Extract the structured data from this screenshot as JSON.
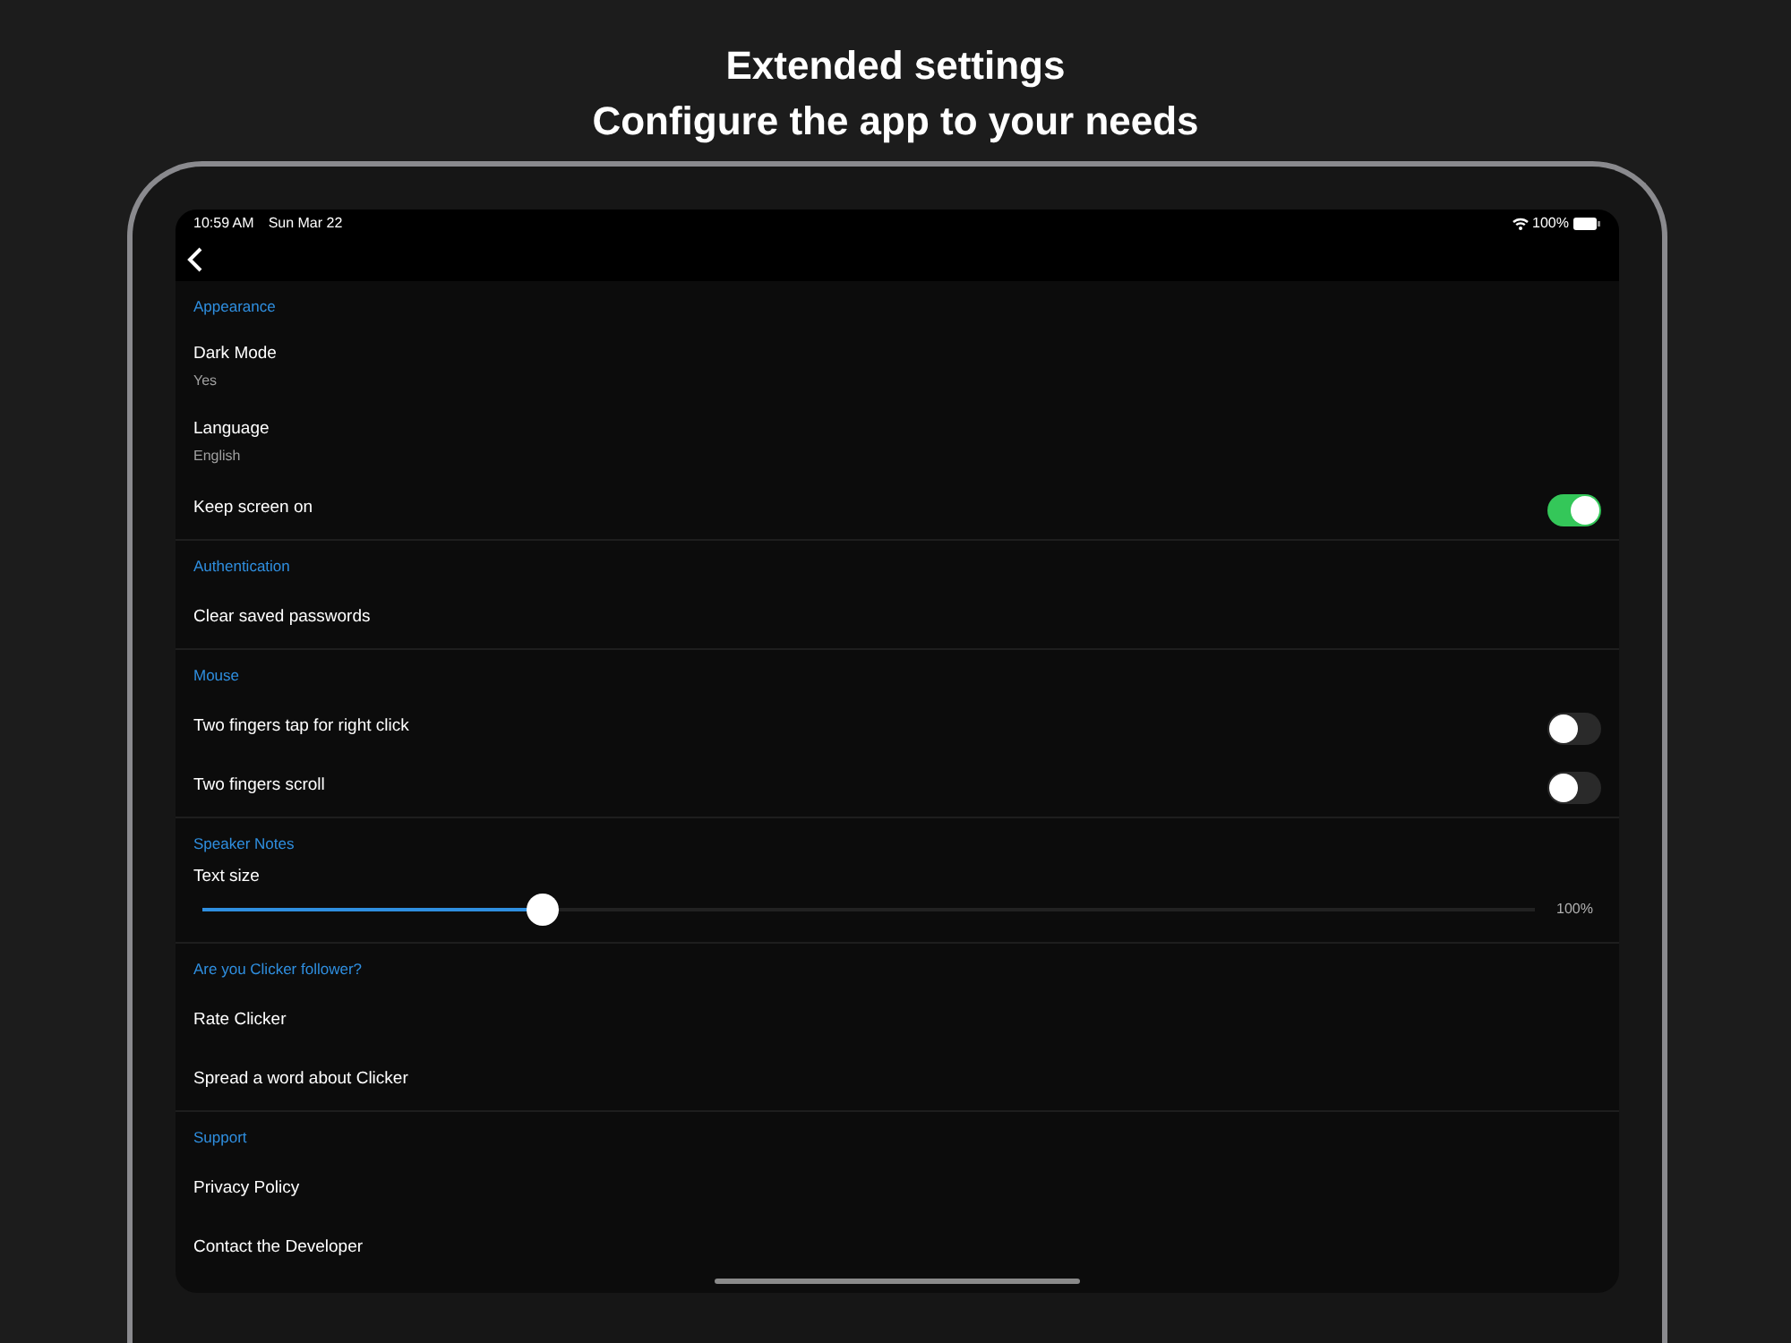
{
  "headline": [
    "Extended settings",
    "Configure the app to your needs"
  ],
  "status_bar": {
    "time": "10:59 AM",
    "date": "Sun Mar 22",
    "battery": "100%"
  },
  "sections": [
    {
      "title": "Appearance",
      "items": [
        {
          "kind": "detail",
          "label": "Dark Mode",
          "value": "Yes"
        },
        {
          "kind": "detail",
          "label": "Language",
          "value": "English"
        },
        {
          "kind": "toggle",
          "label": "Keep screen on",
          "on": true
        }
      ]
    },
    {
      "title": "Authentication",
      "items": [
        {
          "kind": "action",
          "label": "Clear saved passwords"
        }
      ]
    },
    {
      "title": "Mouse",
      "items": [
        {
          "kind": "toggle",
          "label": "Two fingers tap for right click",
          "on": false
        },
        {
          "kind": "toggle",
          "label": "Two fingers scroll",
          "on": false
        }
      ]
    },
    {
      "title": "Speaker Notes",
      "items": [
        {
          "kind": "slider",
          "label": "Text size",
          "level": 0.255,
          "reading": "100%"
        }
      ]
    },
    {
      "title": "Are you Clicker follower?",
      "items": [
        {
          "kind": "action",
          "label": "Rate Clicker"
        },
        {
          "kind": "action",
          "label": "Spread a word about Clicker"
        }
      ]
    },
    {
      "title": "Support",
      "items": [
        {
          "kind": "action",
          "label": "Privacy Policy"
        },
        {
          "kind": "action",
          "label": "Contact the Developer"
        }
      ]
    }
  ]
}
